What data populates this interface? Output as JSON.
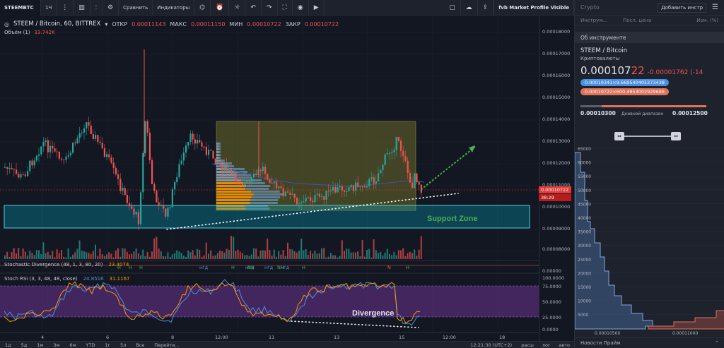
{
  "toolbar": {
    "symbol": "STEEMBTC",
    "interval": "1Ч",
    "compare_label": "Сравнить",
    "indicators_label": "Индикаторы",
    "fvb_label": "fvb Market Profile Visible"
  },
  "legend": {
    "pair": "STEEM / Bitcoin, 60, BITTREX",
    "open_label": "ОТКР",
    "open_value": "0.00011143",
    "high_label": "МАКС",
    "high_value": "0.00011150",
    "low_label": "МИН",
    "low_value": "0.00010722",
    "close_label": "ЗАКР",
    "close_value": "0.00010722",
    "volume_label": "Объём (1)",
    "volume_value": "33.742K"
  },
  "indicators": {
    "stoch_div_label": "Stochastic Divergence (48, 1, 3, 80, 20)",
    "stoch_div_value": "23.4074",
    "stoch_rsi_label": "Stoch RSI (3, 3, 48, 48, close)",
    "stoch_rsi_k": "24.8516",
    "stoch_rsi_d": "31.1167",
    "div_markers": [
      "H",
      "H",
      "H",
      "нгд",
      "H",
      "нгд",
      "NH",
      "нгд",
      "NH",
      "нгд",
      "H",
      "N",
      "H"
    ]
  },
  "annotations": {
    "support": "Support Zone",
    "divergence": "Divergence"
  },
  "price_scale": {
    "ticks": [
      "0.00018000",
      "0.00017000",
      "0.00016000",
      "0.00015000",
      "0.00014000",
      "0.00013000",
      "0.00012000",
      "0.00011000",
      "0.00010000",
      "0.00009000",
      "0.00008000",
      "0.00000"
    ],
    "last_price": "0.00010722",
    "countdown": "38:29",
    "rsi_ticks": [
      "100.0000",
      "75.0000",
      "50.0000",
      "25.0000",
      "0.0000"
    ]
  },
  "time_axis": {
    "labels": [
      "4",
      "6",
      "8",
      "12:00",
      "11",
      "13",
      "15",
      "12:00",
      "18"
    ]
  },
  "bottom_bar": {
    "ranges": [
      "1д",
      "5д",
      "1м",
      "3м",
      "6м",
      "YTD",
      "1г",
      "5л",
      "Все",
      "Перейти..."
    ],
    "clock": "12:21:30 (UTC+2)",
    "options": [
      "расш",
      "лог",
      "авто"
    ]
  },
  "panel": {
    "header_title": "Crypto",
    "add_button": "Добавить инстр",
    "col_instrument": "Инструм...",
    "col_price": "Посл. цена",
    "col_change": "Изм. (%)",
    "section_title": "Об инструменте",
    "symbol_name": "STEEM / Bitcoin",
    "symbol_type": "Криптовалюты",
    "price_main": "0.000107",
    "price_tail": "22",
    "change": "-0.00001762 (-14",
    "bid": "0.00010341×9.669540405273438",
    "ask": "0.00010722×600.4953002929688",
    "range_low": "0.00010300",
    "range_label": "Дневной диапазон",
    "range_high": "0.00012500",
    "depth_y_ticks": [
      "65000",
      "60000",
      "55000",
      "50000",
      "45000",
      "40000",
      "35000",
      "30000",
      "25000",
      "20000",
      "15000",
      "10000",
      "5000"
    ],
    "depth_x_ticks": [
      "0.00010500",
      "0.00011000"
    ],
    "news_label": "Новости Прайм"
  },
  "colors": {
    "up": "#26a69a",
    "down": "#ef5350",
    "support": "#00bcd4",
    "accent_green": "#4caf50"
  }
}
